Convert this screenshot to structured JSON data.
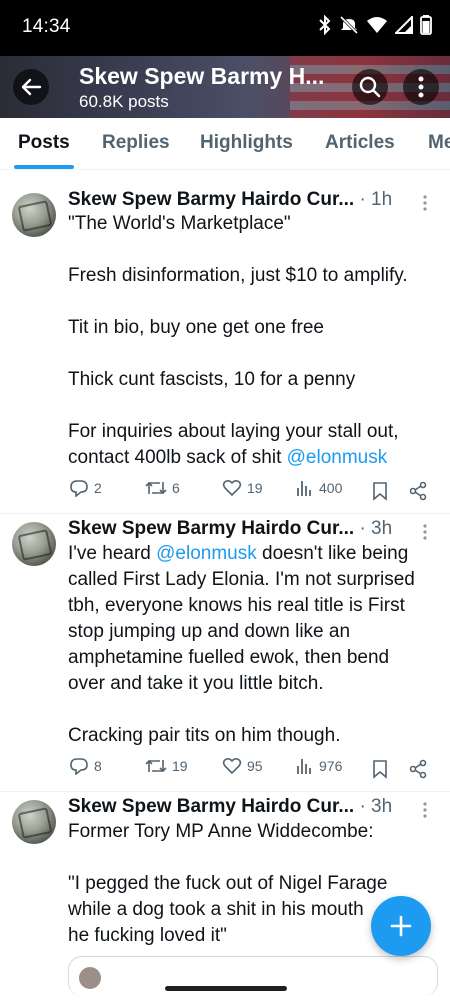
{
  "status_bar": {
    "time": "14:34",
    "icons": [
      "bluetooth-icon",
      "mute-icon",
      "wifi-icon",
      "signal-icon",
      "battery-icon"
    ]
  },
  "header": {
    "title": "Skew Spew Barmy H...",
    "subtitle": "60.8K posts",
    "icons": [
      "back-arrow-icon",
      "search-icon",
      "more-vertical-icon"
    ]
  },
  "tabs": [
    {
      "label": "Posts",
      "active": true
    },
    {
      "label": "Replies",
      "active": false
    },
    {
      "label": "Highlights",
      "active": false
    },
    {
      "label": "Articles",
      "active": false
    },
    {
      "label": "Me",
      "active": false
    }
  ],
  "posts": [
    {
      "author": "Skew Spew Barmy Hairdo Cur...",
      "time": "· 1h",
      "lines": [
        "\"The World's Marketplace\"",
        "",
        "Fresh disinformation, just $10 to amplify.",
        "",
        "Tit in bio, buy one get one free",
        "",
        "Thick cunt fascists, 10 for a penny",
        "",
        "For inquiries about laying your stall out,",
        "contact 400lb sack of shit",
        "@elonmusk"
      ],
      "stats": {
        "replies": "2",
        "reposts": "6",
        "likes": "19",
        "views": "400"
      }
    },
    {
      "author": "Skew Spew Barmy Hairdo Cur...",
      "time": "· 3h",
      "lines": [
        "I've heard",
        "@elonmusk",
        "doesn't like being",
        "called First Lady Elonia. I'm not surprised",
        "tbh, everyone knows his real title is First",
        "stop jumping up and down like an",
        "amphetamine fuelled ewok, then bend",
        "over and take it you little bitch.",
        "",
        "Cracking pair tits on him though."
      ],
      "stats": {
        "replies": "8",
        "reposts": "19",
        "likes": "95",
        "views": "976"
      }
    },
    {
      "author": "Skew Spew Barmy Hairdo Cur...",
      "time": "· 3h",
      "lines": [
        "Former Tory MP Anne Widdecombe:",
        "",
        "\"I pegged the fuck out of Nigel Farage",
        "while a dog took a shit in his mouth",
        "he fucking loved it\""
      ]
    }
  ],
  "colors": {
    "accent": "#1d9bf0",
    "text": "#0f1419",
    "secondary": "#536471"
  }
}
